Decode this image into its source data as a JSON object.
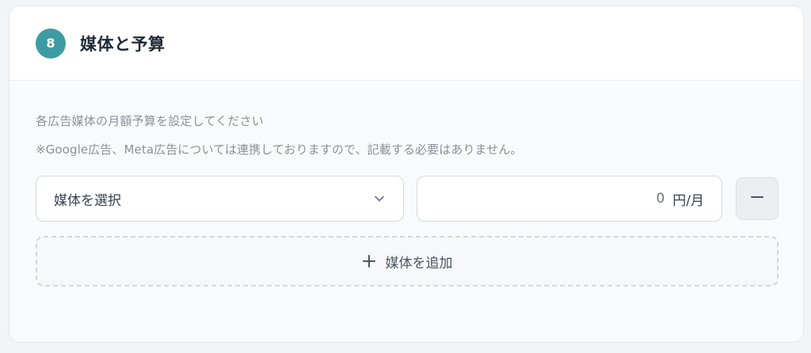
{
  "section": {
    "step_number": "8",
    "title": "媒体と予算",
    "badge_color": "#3d9ca3"
  },
  "body": {
    "description": "各広告媒体の月額予算を設定してください",
    "note": "※Google広告、Meta広告については連携しておりますので、記載する必要はありません。"
  },
  "media_row": {
    "select_label": "媒体を選択",
    "select_icon": "chevron-down-icon",
    "budget_value": "0",
    "budget_unit": "円/月",
    "remove_icon": "minus-icon"
  },
  "add_button": {
    "label": "媒体を追加",
    "icon": "plus-icon"
  }
}
